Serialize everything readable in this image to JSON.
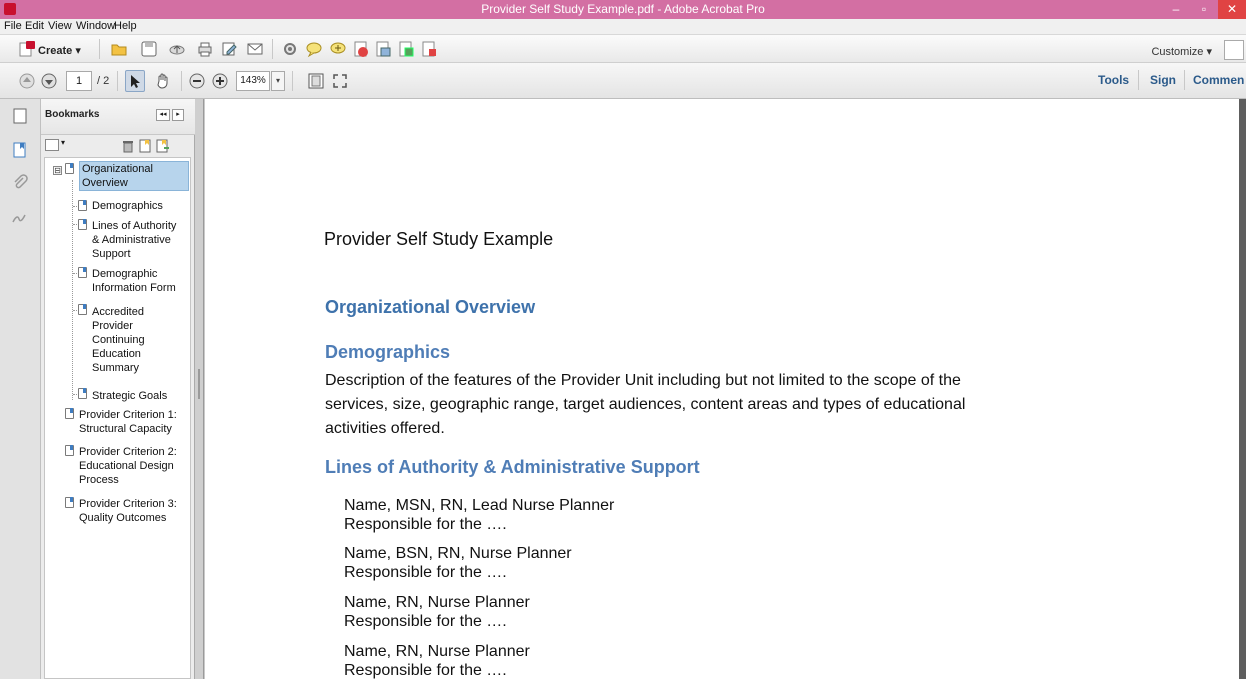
{
  "window": {
    "title": "Provider Self Study Example.pdf - Adobe Acrobat Pro",
    "minimize": "–",
    "maximize": "▫",
    "close": "✕"
  },
  "menu": [
    "File",
    "Edit",
    "View",
    "Window",
    "Help"
  ],
  "toolbar": {
    "create_label": "Create",
    "create_arrow": "▾",
    "customize_label": "Customize",
    "customize_arrow": "▾",
    "page_current": "1",
    "page_of": "/ 2",
    "zoom": "143%",
    "zoom_arrow": "▾"
  },
  "right_tabs": [
    "Tools",
    "Sign",
    "Commen"
  ],
  "bookmarks": {
    "title": "Bookmarks",
    "collapse_symbol": "⊟",
    "options_arrow": "▾",
    "panel_prev": "◂◂",
    "panel_next": "▸",
    "items": [
      {
        "label_lines": [
          "Organizational",
          "Overview"
        ]
      },
      {
        "label_lines": [
          "Demographics"
        ]
      },
      {
        "label_lines": [
          "Lines of Authority",
          "& Administrative",
          "Support"
        ]
      },
      {
        "label_lines": [
          "Demographic",
          "Information Form"
        ]
      },
      {
        "label_lines": [
          "Accredited",
          "Provider",
          "Continuing",
          "Education",
          "Summary"
        ]
      },
      {
        "label_lines": [
          "Strategic Goals"
        ]
      },
      {
        "label_lines": [
          "Provider Criterion 1:",
          "Structural Capacity"
        ]
      },
      {
        "label_lines": [
          "Provider Criterion 2:",
          "Educational Design",
          "Process"
        ]
      },
      {
        "label_lines": [
          "Provider Criterion 3:",
          "Quality Outcomes"
        ]
      }
    ]
  },
  "document": {
    "title": "Provider Self Study Example",
    "heading_org": "Organizational Overview",
    "heading_demo": "Demographics",
    "demo_paragraph_lines": [
      "Description of the features of the Provider Unit including but not limited to the scope of the",
      "services, size, geographic range, target audiences, content areas and types of educational",
      "activities offered."
    ],
    "heading_lines": "Lines of Authority & Administrative Support",
    "staff": [
      {
        "name": "Name, MSN, RN, Lead Nurse Planner",
        "resp": "Responsible for the …."
      },
      {
        "name": "Name, BSN, RN, Nurse Planner",
        "resp": "Responsible for the …."
      },
      {
        "name": "Name, RN, Nurse Planner",
        "resp": "Responsible for the …."
      },
      {
        "name": "Name, RN, Nurse Planner",
        "resp": "Responsible for the …."
      }
    ]
  },
  "colors": {
    "titlebar": "#d36fa3",
    "heading_blue": "#4f7db6",
    "selection": "#b7d4ec"
  }
}
